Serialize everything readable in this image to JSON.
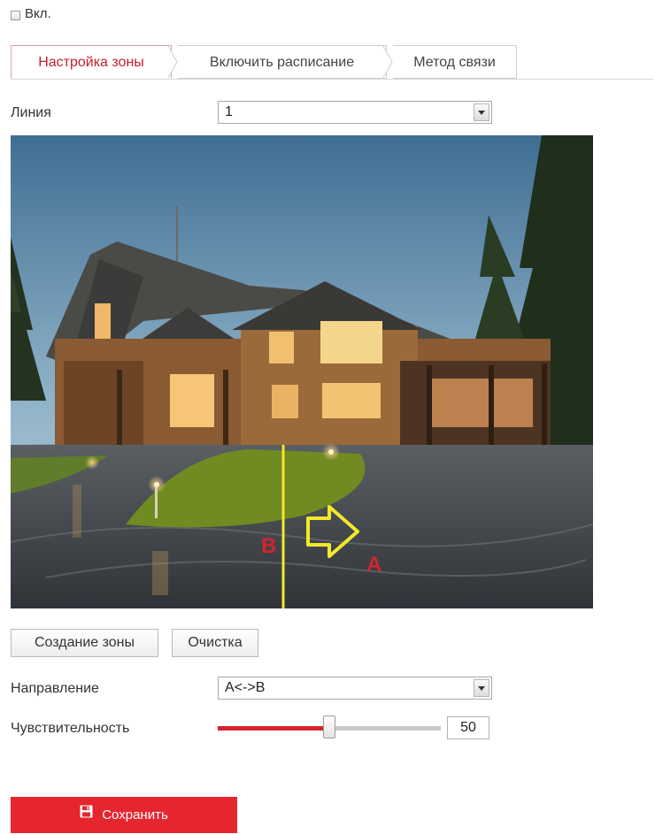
{
  "enable": {
    "label": "Вкл.",
    "checked": false
  },
  "tabs": [
    {
      "label": "Настройка зоны",
      "active": true
    },
    {
      "label": "Включить расписание",
      "active": false
    },
    {
      "label": "Метод связи",
      "active": false
    }
  ],
  "line": {
    "label": "Линия",
    "value": "1"
  },
  "preview": {
    "marker_b": "B",
    "marker_a": "A"
  },
  "buttons": {
    "create": "Создание зоны",
    "clear": "Очистка"
  },
  "direction": {
    "label": "Направление",
    "value": "A<->B"
  },
  "sensitivity": {
    "label": "Чувствительность",
    "value": "50",
    "level_percent": 50
  },
  "save": {
    "label": "Сохранить"
  },
  "colors": {
    "accent": "#e5262f",
    "active_tab_text": "#c42030",
    "line_marker": "#f3e82a"
  },
  "icons": {
    "save": "floppy-disk-icon",
    "dropdown": "chevron-down-icon"
  }
}
